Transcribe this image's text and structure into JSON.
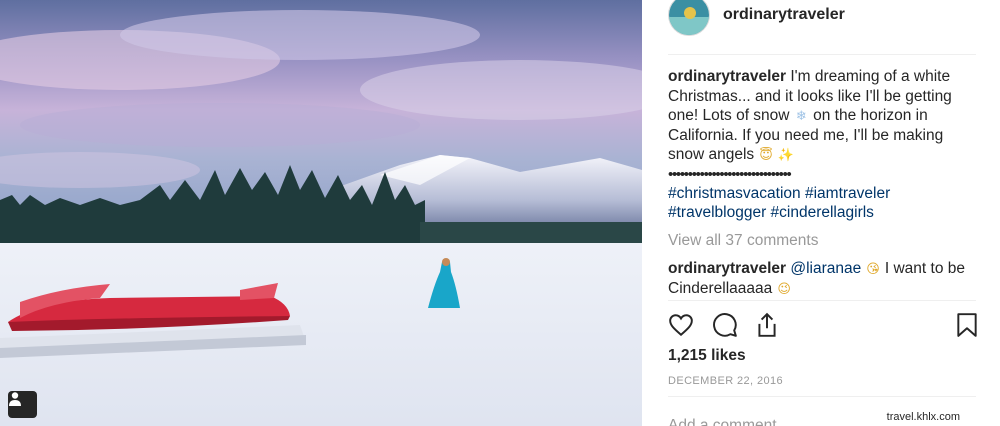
{
  "post": {
    "username": "ordinarytraveler",
    "caption": {
      "user": "ordinarytraveler",
      "text_part1": "I'm dreaming of a white Christmas... and it looks like I'll be getting one! Lots of snow",
      "text_part2": "on the horizon in California. If you need me, I'll be making snow angels",
      "snowflake_emoji": "❄",
      "halo_emoji": "😇",
      "sparkles_emoji": "✨",
      "dots": "•••••••••••••••••••••••••••••••",
      "hashtags_line1": "#christmasvacation #iamtraveler",
      "hashtags_line2": "#travelblogger #cinderellagirls"
    },
    "view_all_comments": "View all 37 comments",
    "comment": {
      "user": "ordinarytraveler",
      "mention": "@liaranae",
      "wink_emoji": "😘",
      "text": "I want to be Cinderellaaaaa",
      "smile_emoji": "😉"
    },
    "likes": "1,215 likes",
    "date": "DECEMBER 22, 2016",
    "add_comment_placeholder": "Add a comment...",
    "watermark": "travel.khlx.com"
  },
  "icons": {
    "like": "heart-icon",
    "comment": "comment-bubble-icon",
    "share": "share-upload-icon",
    "save": "bookmark-icon",
    "tag": "user-tag-icon"
  },
  "colors": {
    "text": "#262626",
    "muted": "#999999",
    "link": "#003569",
    "canoe": "#d6293f",
    "dress": "#19a6c9"
  }
}
